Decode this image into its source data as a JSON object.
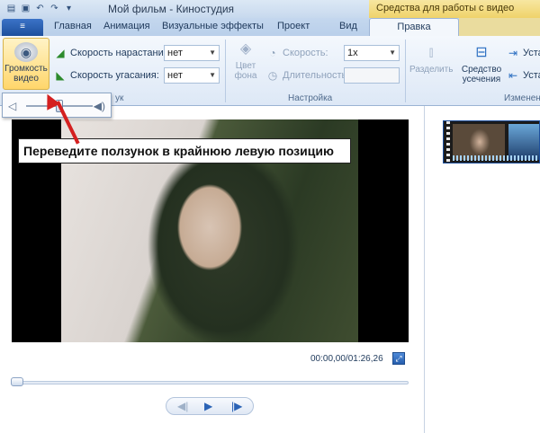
{
  "window": {
    "title": "Мой фильм - Киностудия",
    "context_title": "Средства для работы с видео"
  },
  "tabs": {
    "file": "≡",
    "items": [
      "Главная",
      "Анимация",
      "Визуальные эффекты",
      "Проект",
      "Вид"
    ],
    "active": "Правка"
  },
  "ribbon": {
    "volume_button": "Громкость видео",
    "fade_in_label": "Скорость нарастания:",
    "fade_in_value": "нет",
    "fade_out_label": "Скорость угасания:",
    "fade_out_value": "нет",
    "bg_color_label": "Цвет фона",
    "speed_label": "Скорость:",
    "speed_value": "1x",
    "duration_label": "Длительность:",
    "duration_value": "",
    "group_settings": "Настройка",
    "group_audio": "ук",
    "split_label": "Разделить",
    "trim_label": "Средство усечения",
    "set_start": "Устан",
    "set_end": "Устан",
    "group_edit": "Изменен"
  },
  "volume_popup": {
    "level_fraction": 0.5
  },
  "preview": {
    "callout": "Переведите ползунок в крайнюю левую позицию",
    "time": "00:00,00/01:26,26"
  }
}
